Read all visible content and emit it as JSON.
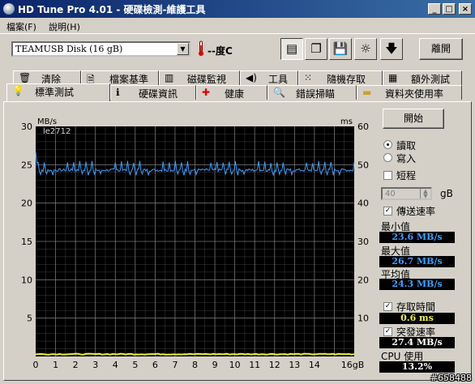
{
  "window": {
    "title": "HD Tune Pro 4.01 - 硬碟檢測-維護工具"
  },
  "menu": {
    "file": "檔案(F)",
    "help": "說明(H)"
  },
  "toolbar": {
    "drive": "TEAMUSB Disk (16 gB)",
    "temperature": "--度C",
    "exit_label": "離開"
  },
  "tabs_top": [
    {
      "label": "清除"
    },
    {
      "label": "檔案基準"
    },
    {
      "label": "磁碟監視"
    },
    {
      "label": "工具"
    },
    {
      "label": "隨機存取"
    },
    {
      "label": "額外測試"
    }
  ],
  "tabs_bottom": [
    {
      "label": "標準測試"
    },
    {
      "label": "硬碟資訊"
    },
    {
      "label": "健康"
    },
    {
      "label": "錯誤掃瞄"
    },
    {
      "label": "資料夾使用率"
    }
  ],
  "controls": {
    "start_label": "開始",
    "read_label": "讀取",
    "write_label": "寫入",
    "short_stroke_label": "短程",
    "short_stroke_value": "40",
    "short_stroke_unit": "gB",
    "transfer_rate_label": "傳送速率",
    "min_label": "最小值",
    "min_value": "23.6 MB/s",
    "max_label": "最大值",
    "max_value": "26.7 MB/s",
    "avg_label": "平均值",
    "avg_value": "24.3 MB/s",
    "access_time_label": "存取時間",
    "access_time_value": "0.6 ms",
    "burst_rate_label": "突發速率",
    "burst_rate_value": "27.4 MB/s",
    "cpu_label": "CPU 使用",
    "cpu_value": "13.2%"
  },
  "colors": {
    "plot_bg": "#000000",
    "grid": "#808080",
    "transfer": "#3aa0ff",
    "access": "#f0f040"
  },
  "chart_data": {
    "type": "line",
    "annotation": "le2712",
    "y_left_label": "MB/s",
    "y_right_label": "ms",
    "y_left_ticks": [
      "30",
      "25",
      "20",
      "15",
      "10",
      "5"
    ],
    "y_right_ticks": [
      "60",
      "50",
      "40",
      "30",
      "20",
      "10"
    ],
    "x_ticks": [
      "0",
      "1",
      "2",
      "3",
      "4",
      "5",
      "6",
      "7",
      "8",
      "9",
      "10",
      "11",
      "12",
      "13",
      "14",
      "16gB"
    ],
    "ylim_left": [
      0,
      30
    ],
    "ylim_right": [
      0,
      60
    ],
    "xlim": [
      0,
      16
    ],
    "series": [
      {
        "kind": "transfer",
        "start": 26.7,
        "base": 24.3,
        "min": 23.6,
        "max": 25.5,
        "spike_every_gb": 0.3
      },
      {
        "kind": "access",
        "value_ms": 0.6
      }
    ]
  },
  "watermark": "#658488"
}
